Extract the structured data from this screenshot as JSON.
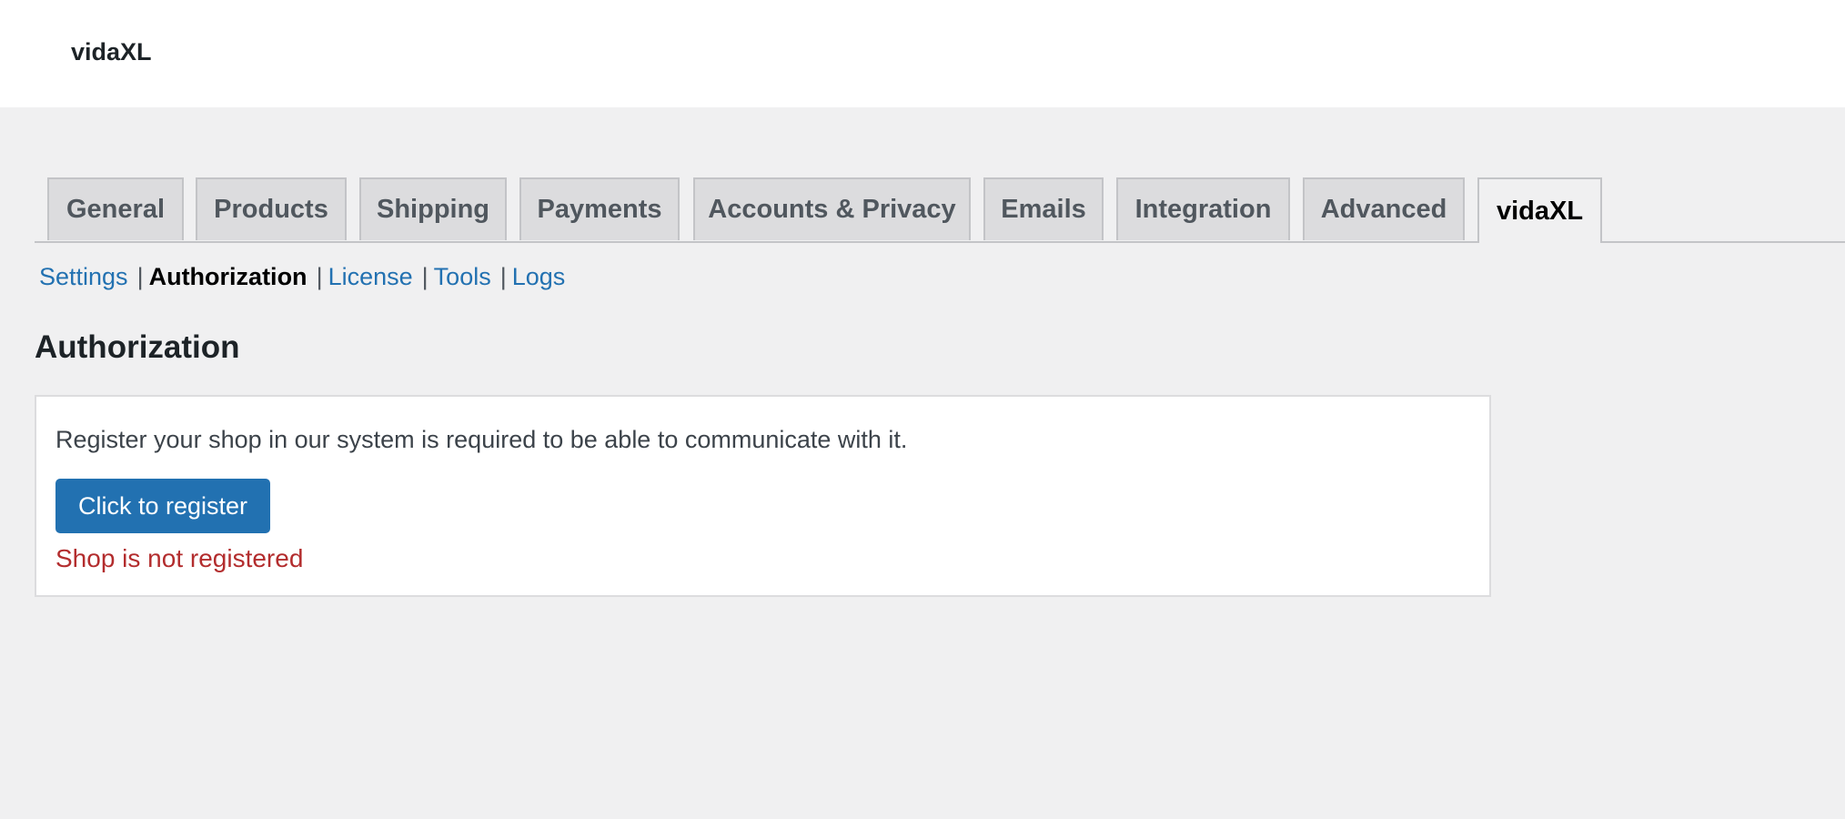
{
  "header": {
    "title": "vidaXL"
  },
  "tabs": [
    {
      "label": "General"
    },
    {
      "label": "Products"
    },
    {
      "label": "Shipping"
    },
    {
      "label": "Payments"
    },
    {
      "label": "Accounts & Privacy"
    },
    {
      "label": "Emails"
    },
    {
      "label": "Integration"
    },
    {
      "label": "Advanced"
    },
    {
      "label": "vidaXL",
      "active": true
    }
  ],
  "subnav": {
    "items": [
      {
        "label": "Settings"
      },
      {
        "label": "Authorization",
        "current": true
      },
      {
        "label": "License"
      },
      {
        "label": "Tools"
      },
      {
        "label": "Logs"
      }
    ],
    "separator": "|"
  },
  "section": {
    "title": "Authorization",
    "description": "Register your shop in our system is required to be able to communicate with it.",
    "button_label": "Click to register",
    "status": "Shop is not registered"
  },
  "colors": {
    "accent": "#2271b1",
    "error": "#b32d2e",
    "background": "#f0f0f1"
  }
}
